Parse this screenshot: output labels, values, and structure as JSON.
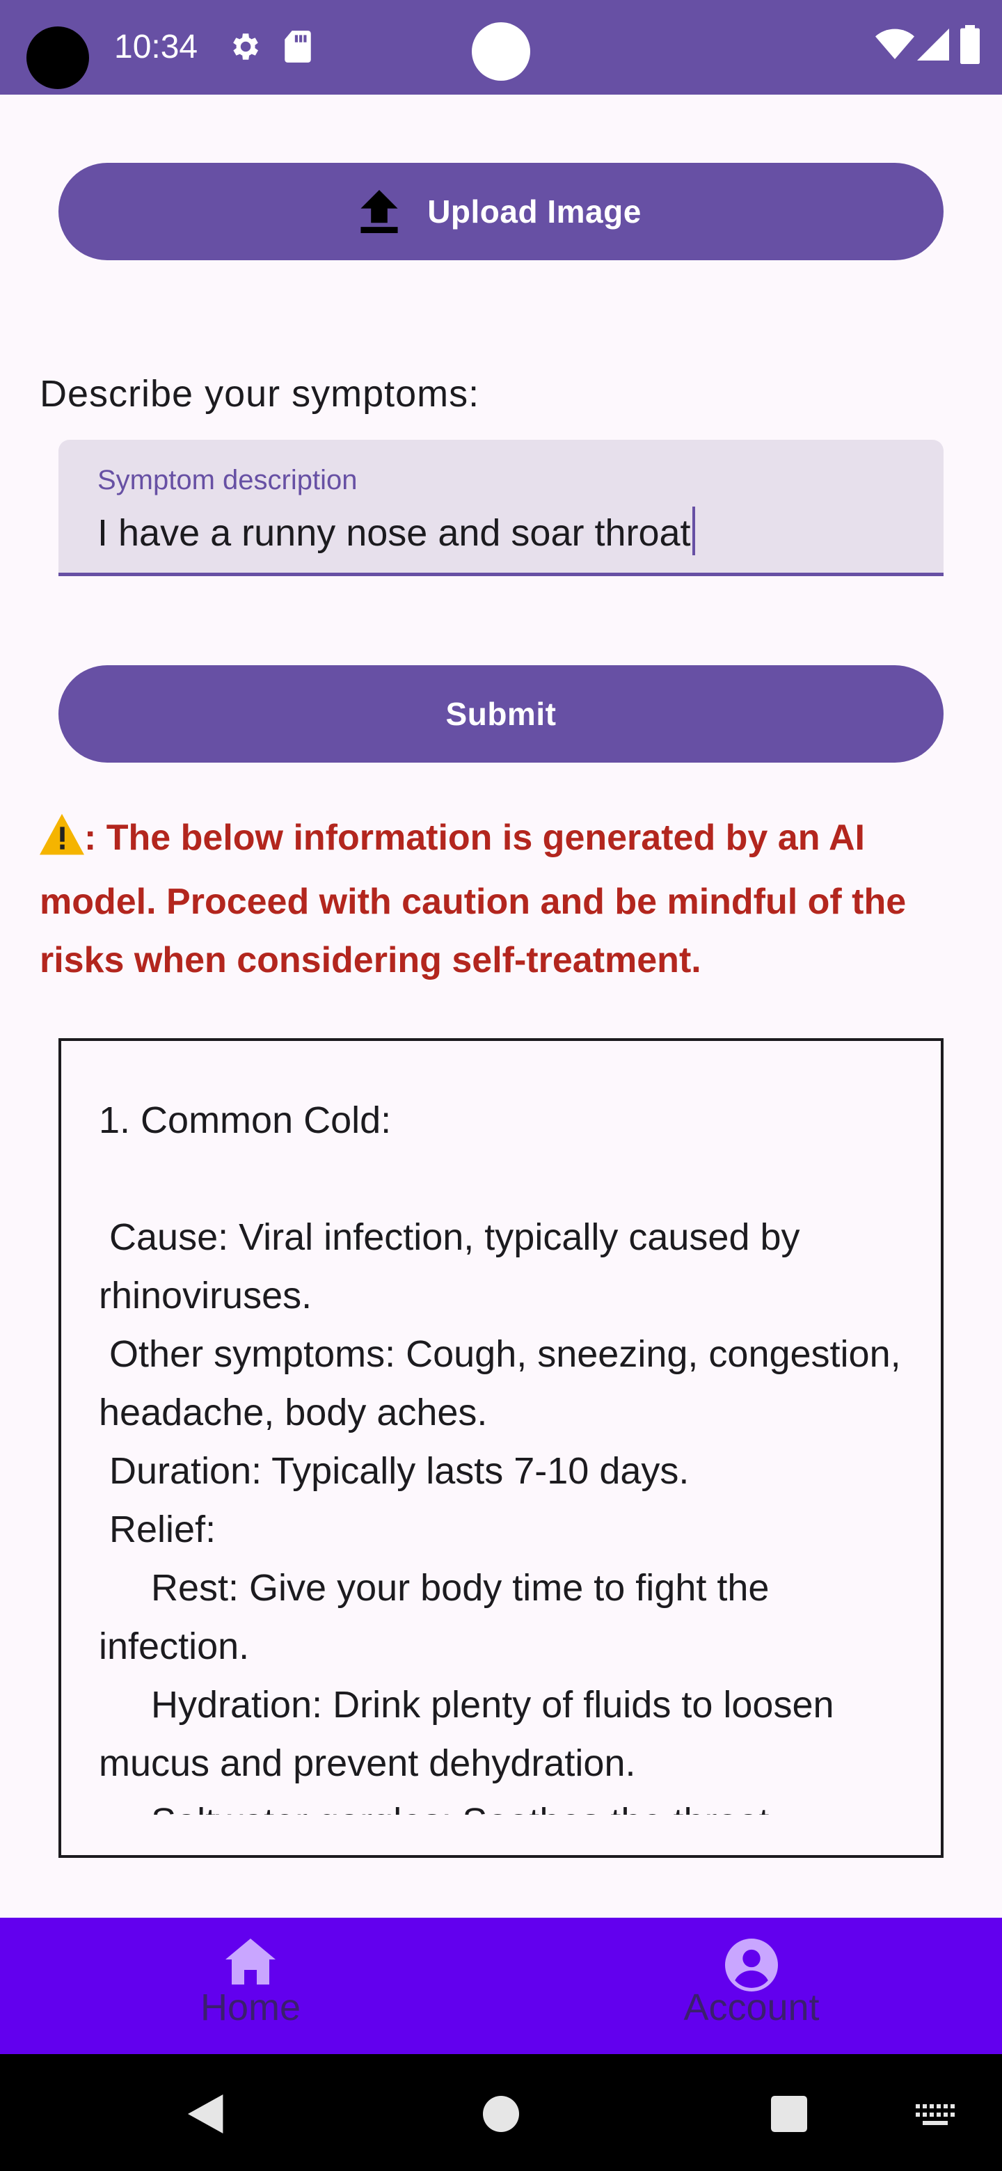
{
  "status_bar": {
    "time": "10:34",
    "icons": [
      "settings-icon",
      "sd-card-icon",
      "wifi-icon",
      "signal-icon",
      "battery-icon"
    ],
    "background": "#6750a4"
  },
  "upload_button": {
    "label": "Upload Image",
    "icon": "upload-icon"
  },
  "symptoms_prompt": "Describe your symptoms:",
  "symptom_field": {
    "label": "Symptom description",
    "value": "I have a runny nose and soar throat"
  },
  "submit_button": {
    "label": "Submit"
  },
  "warning": {
    "icon": "warning-icon",
    "text": ": The below information is generated by an AI model. Proceed with caution and be mindful of the risks when considering self-treatment.",
    "color": "#b3261e"
  },
  "result": {
    "text": "1. Common Cold:\n\n Cause: Viral infection, typically caused by rhinoviruses.\n Other symptoms: Cough, sneezing, congestion, headache, body aches.\n Duration: Typically lasts 7-10 days.\n Relief:\n     Rest: Give your body time to fight the infection.\n     Hydration: Drink plenty of fluids to loosen mucus and prevent dehydration.\n     Saltwater gargles: Soothes the throat"
  },
  "bottom_nav": {
    "background": "#6200ee",
    "items": [
      {
        "label": "Home",
        "icon": "home-icon"
      },
      {
        "label": "Account",
        "icon": "account-icon"
      }
    ]
  },
  "system_nav": {
    "buttons": [
      "back-icon",
      "home-circle-icon",
      "recents-icon",
      "keyboard-icon"
    ]
  },
  "accent_color": "#6750a4"
}
